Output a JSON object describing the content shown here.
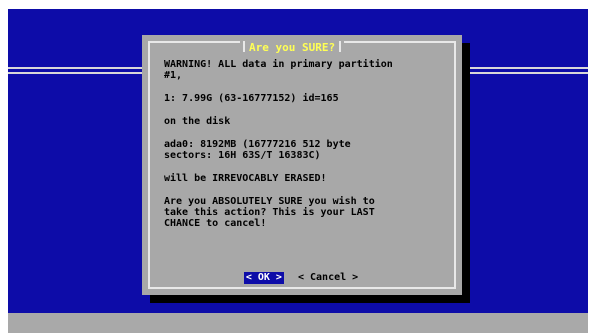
{
  "dialog": {
    "title": "Are you SURE?",
    "messages": [
      "WARNING! ALL data in primary partition\n#1,",
      "1: 7.99G (63-16777152) id=165",
      "on the disk",
      "ada0: 8192MB (16777216 512 byte\nsectors: 16H 63S/T 16383C)",
      "will be IRREVOCABLY ERASED!",
      "Are you ABSOLUTELY SURE you wish to\ntake this action? This is your LAST\nCHANCE to cancel!"
    ],
    "ok_label": "< OK >",
    "cancel_label": "< Cancel >"
  },
  "colors": {
    "screen_bg": "#0d0ca8",
    "dialog_bg": "#a8a8a8",
    "title_text": "#ffff55",
    "selected_button_bg": "#0d0ca8"
  }
}
